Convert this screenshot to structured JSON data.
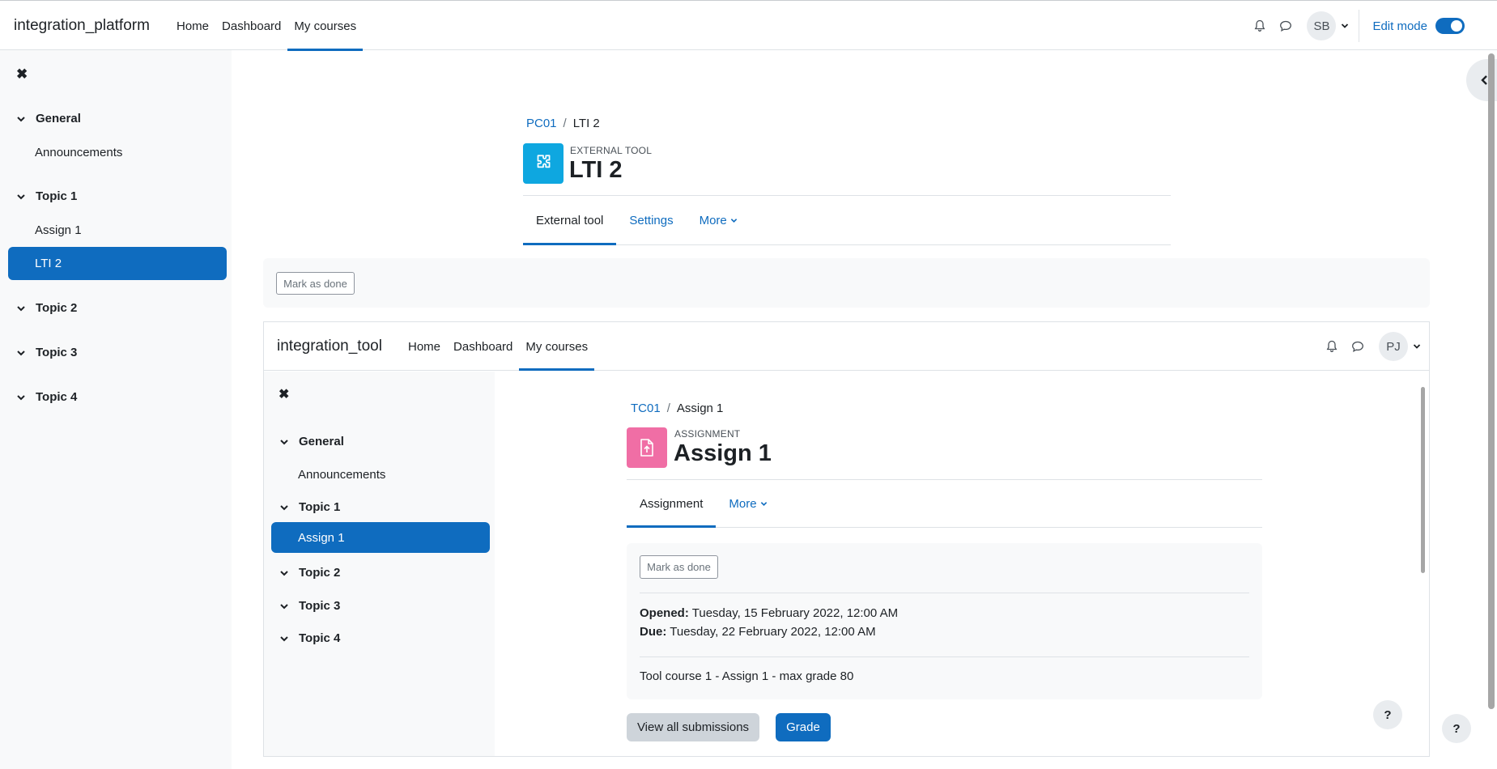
{
  "platform": {
    "brand": "integration_platform",
    "nav": [
      "Home",
      "Dashboard",
      "My courses"
    ],
    "user_initials": "SB",
    "edit_mode_label": "Edit mode"
  },
  "course_index": {
    "close": "✖",
    "general": "General",
    "announcements": "Announcements",
    "topic1": "Topic 1",
    "assign1": "Assign 1",
    "lti2": "LTI 2",
    "topic2": "Topic 2",
    "topic3": "Topic 3",
    "topic4": "Topic 4"
  },
  "page": {
    "breadcrumb_course": "PC01",
    "breadcrumb_sep": "/",
    "breadcrumb_current": "LTI 2",
    "purpose": "EXTERNAL TOOL",
    "title": "LTI 2",
    "tabs": [
      "External tool",
      "Settings",
      "More"
    ],
    "mark_done": "Mark as done"
  },
  "tool": {
    "brand": "integration_tool",
    "nav": [
      "Home",
      "Dashboard",
      "My courses"
    ],
    "user_initials": "PJ",
    "course_index": {
      "close": "✖",
      "general": "General",
      "announcements": "Announcements",
      "topic1": "Topic 1",
      "assign1": "Assign 1",
      "topic2": "Topic 2",
      "topic3": "Topic 3",
      "topic4": "Topic 4"
    },
    "breadcrumb_course": "TC01",
    "breadcrumb_sep": "/",
    "breadcrumb_current": "Assign 1",
    "purpose": "ASSIGNMENT",
    "title": "Assign 1",
    "tabs": [
      "Assignment",
      "More"
    ],
    "mark_done": "Mark as done",
    "opened_label": "Opened:",
    "opened_value": "Tuesday, 15 February 2022, 12:00 AM",
    "due_label": "Due:",
    "due_value": "Tuesday, 22 February 2022, 12:00 AM",
    "description": "Tool course 1 - Assign 1 - max grade 80",
    "view_all": "View all submissions",
    "grade": "Grade",
    "help": "?"
  },
  "help_label": "?",
  "colors": {
    "primary": "#0f6cbf",
    "external_tool_icon": "#0ea7e0",
    "assignment_icon": "#f06ea5"
  }
}
